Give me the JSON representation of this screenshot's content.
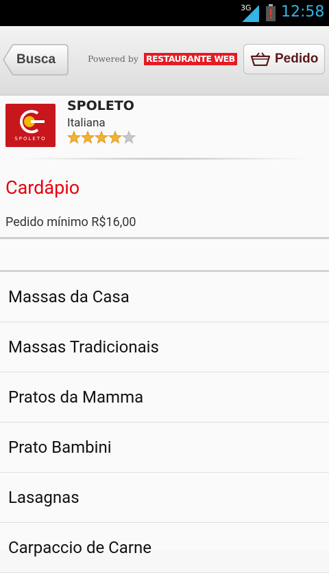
{
  "status_bar": {
    "network": "3G",
    "time": "12:58"
  },
  "header": {
    "back_label": "Busca",
    "powered_by": "Powered by",
    "brand": "RESTAURANTE WEB",
    "order_label": "Pedido"
  },
  "restaurant": {
    "logo_text": "SPOLETO",
    "name": "SPOLETO",
    "cuisine": "Italiana",
    "rating": 4,
    "rating_max": 5
  },
  "section_title": "Cardápio",
  "min_order": "Pedido mínimo R$16,00",
  "menu_items": [
    "Massas da Casa",
    "Massas Tradicionais",
    "Pratos da Mamma",
    "Prato Bambini",
    "Lasagnas",
    "Carpaccio de Carne"
  ],
  "colors": {
    "accent": "#e8000c",
    "status_text": "#33b5e5",
    "logo_bg": "#c8161d"
  }
}
